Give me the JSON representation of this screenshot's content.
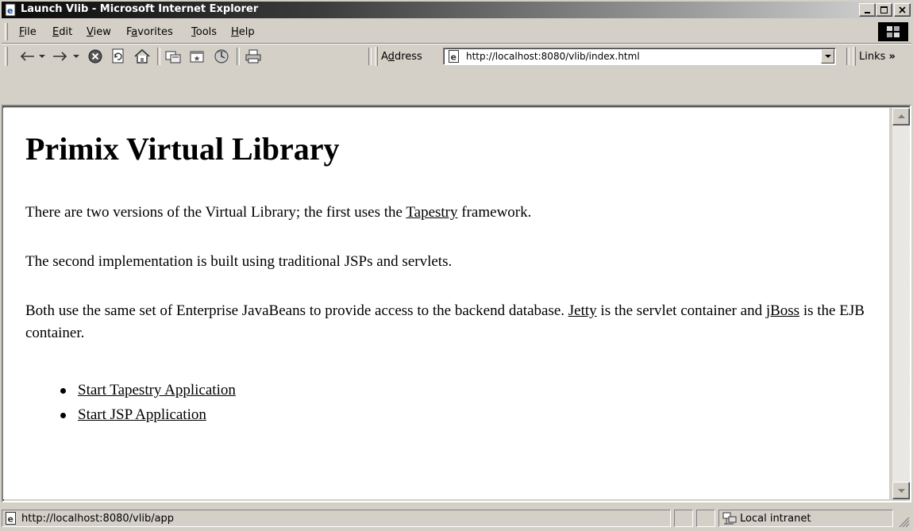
{
  "window": {
    "title": "Launch Vlib - Microsoft Internet Explorer"
  },
  "menu": {
    "file": {
      "prefix": "",
      "accel": "F",
      "rest": "ile"
    },
    "edit": {
      "prefix": "",
      "accel": "E",
      "rest": "dit"
    },
    "view": {
      "prefix": "",
      "accel": "V",
      "rest": "iew"
    },
    "favorites": {
      "prefix": "F",
      "accel": "a",
      "rest": "vorites"
    },
    "tools": {
      "prefix": "",
      "accel": "T",
      "rest": "ools"
    },
    "help": {
      "prefix": "",
      "accel": "H",
      "rest": "elp"
    }
  },
  "toolbar": {
    "address_prefix": "A",
    "address_accel": "d",
    "address_rest": "dress",
    "address_value": "http://localhost:8080/vlib/index.html",
    "links_label": "Links"
  },
  "page": {
    "heading": "Primix Virtual Library",
    "p1_before": "There are two versions of the Virtual Library; the first uses the ",
    "p1_link": "Tapestry",
    "p1_after": " framework.",
    "p2": "The second implementation is built using traditional JSPs and servlets.",
    "p3_before": "Both use the same set of Enterprise JavaBeans to provide access to the backend database. ",
    "p3_link1": "Jetty",
    "p3_middle": " is the servlet container and ",
    "p3_link2": "jBoss",
    "p3_after": " is the EJB container.",
    "links": [
      "Start Tapestry Application",
      "Start JSP Application"
    ]
  },
  "status": {
    "url": "http://localhost:8080/vlib/app",
    "zone": "Local intranet"
  },
  "icon_names": [
    "ie-page-icon",
    "back-icon",
    "forward-icon",
    "stop-icon",
    "refresh-icon",
    "home-icon",
    "search-icon",
    "favorites-icon",
    "history-icon",
    "print-icon",
    "windows-logo-icon",
    "intranet-icon"
  ]
}
